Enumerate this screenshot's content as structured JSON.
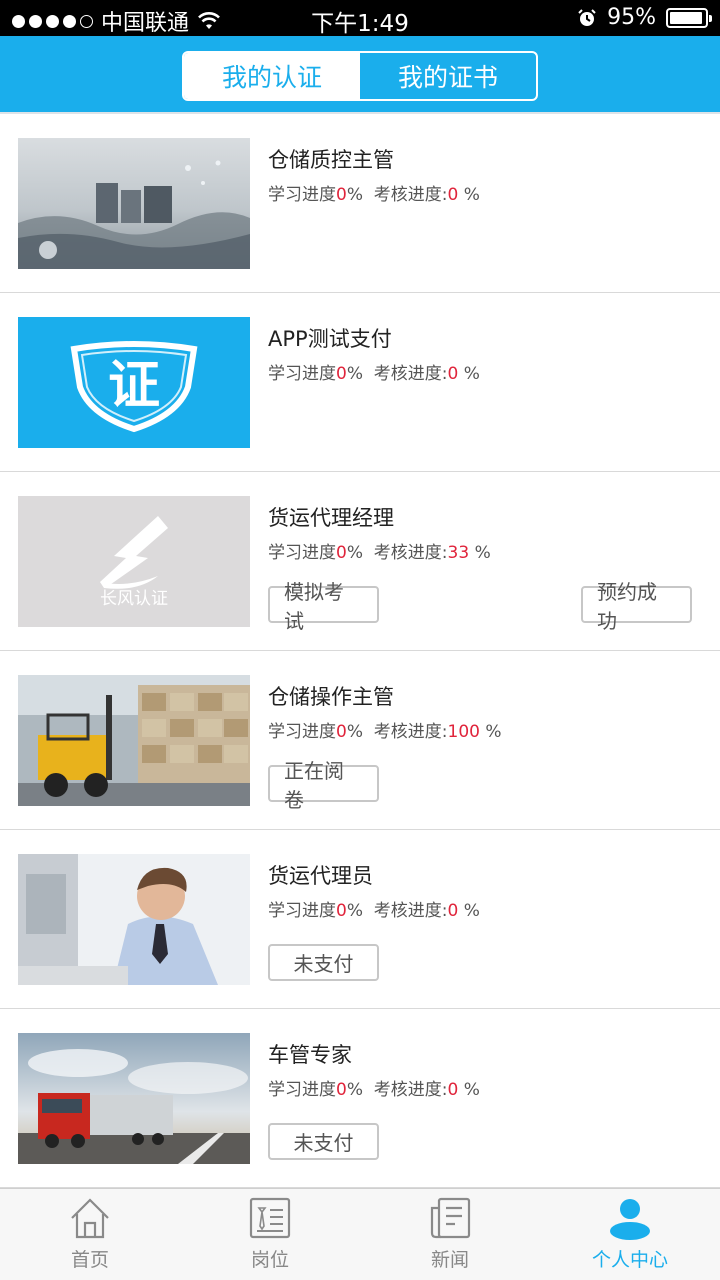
{
  "status_bar": {
    "carrier": "中国联通",
    "time": "下午1:49",
    "battery": "95%"
  },
  "header": {
    "tabs": [
      {
        "label": "我的认证",
        "active": true
      },
      {
        "label": "我的证书",
        "active": false
      }
    ]
  },
  "items": [
    {
      "title": "仓储质控主管",
      "study_label": "学习进度",
      "study_value": "0",
      "exam_label": "考核进度:",
      "exam_value": "0",
      "image": "quality-product-photo"
    },
    {
      "title": "APP测试支付",
      "study_label": "学习进度",
      "study_value": "0",
      "exam_label": "考核进度:",
      "exam_value": "0",
      "image": "certificate-badge",
      "image_text": "证"
    },
    {
      "title": "货运代理经理",
      "study_label": "学习进度",
      "study_value": "0",
      "exam_label": "考核进度:",
      "exam_value": "33",
      "image": "changfeng-logo",
      "image_text": "长风认证",
      "left_button": "模拟考试",
      "right_button": "预约成功"
    },
    {
      "title": "仓储操作主管",
      "study_label": "学习进度",
      "study_value": "0",
      "exam_label": "考核进度:",
      "exam_value": "100",
      "image": "warehouse-forklift-photo",
      "left_button": "正在阅卷"
    },
    {
      "title": "货运代理员",
      "study_label": "学习进度",
      "study_value": "0",
      "exam_label": "考核进度:",
      "exam_value": "0",
      "image": "businessman-photo",
      "left_button": "未支付"
    },
    {
      "title": "车管专家",
      "study_label": "学习进度",
      "study_value": "0",
      "exam_label": "考核进度:",
      "exam_value": "0",
      "image": "red-truck-photo",
      "left_button": "未支付"
    }
  ],
  "tabbar": [
    {
      "label": "首页",
      "icon": "home-icon",
      "active": false
    },
    {
      "label": "岗位",
      "icon": "job-icon",
      "active": false
    },
    {
      "label": "新闻",
      "icon": "news-icon",
      "active": false
    },
    {
      "label": "个人中心",
      "icon": "user-icon",
      "active": true
    }
  ],
  "colors": {
    "accent": "#1aaeec",
    "highlight": "#e0243b"
  }
}
